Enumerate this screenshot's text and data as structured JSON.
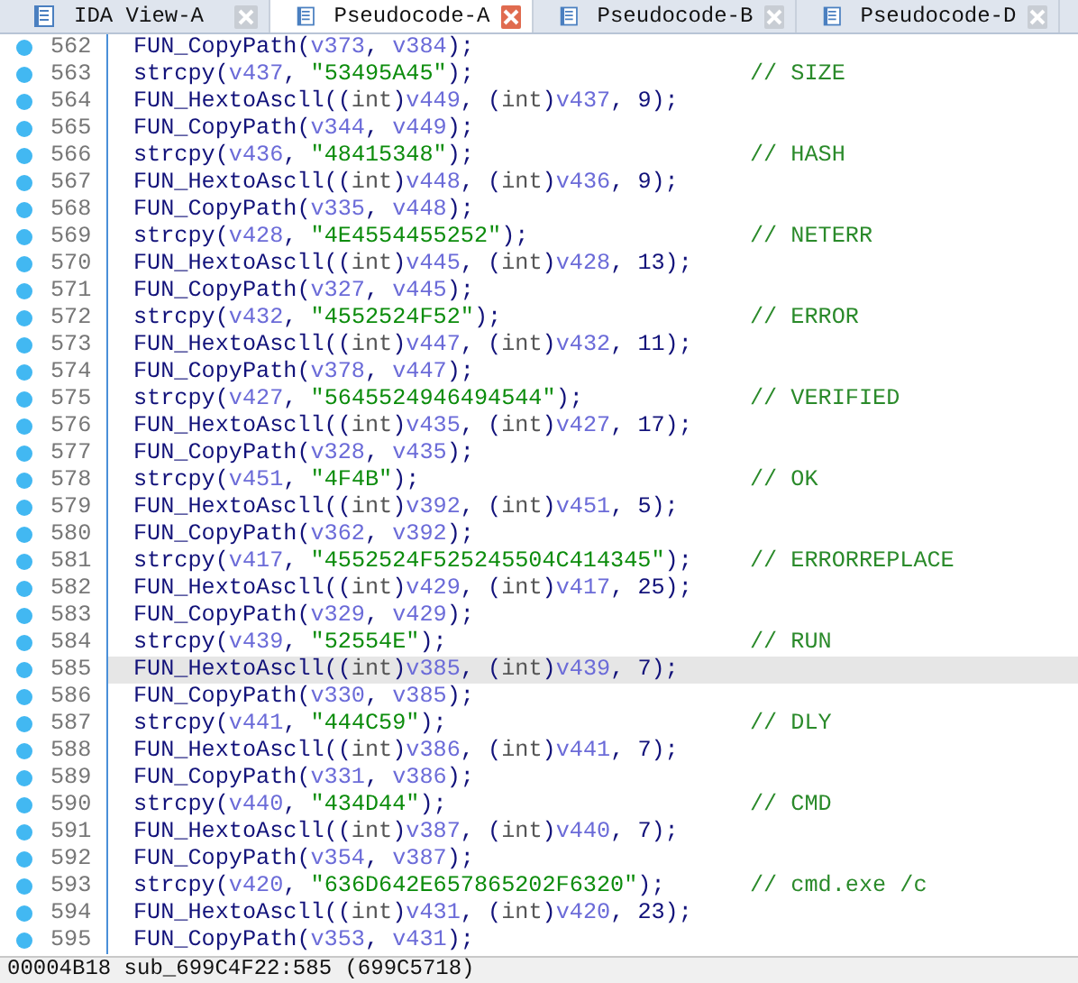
{
  "tabs": [
    {
      "label": "IDA View-A",
      "selected": false
    },
    {
      "label": "Pseudocode-A",
      "selected": true
    },
    {
      "label": "Pseudocode-B",
      "selected": false
    },
    {
      "label": "Pseudocode-D",
      "selected": false
    }
  ],
  "lines": [
    {
      "number": "562",
      "code": "FUN_CopyPath(v373, v384);",
      "current": false
    },
    {
      "number": "563",
      "code": "strcpy(v437, \"53495A45\");",
      "comment": "// SIZE",
      "current": false
    },
    {
      "number": "564",
      "code": "FUN_HextoAscll((int)v449, (int)v437, 9);",
      "current": false
    },
    {
      "number": "565",
      "code": "FUN_CopyPath(v344, v449);",
      "current": false
    },
    {
      "number": "566",
      "code": "strcpy(v436, \"48415348\");",
      "comment": "// HASH",
      "current": false
    },
    {
      "number": "567",
      "code": "FUN_HextoAscll((int)v448, (int)v436, 9);",
      "current": false
    },
    {
      "number": "568",
      "code": "FUN_CopyPath(v335, v448);",
      "current": false
    },
    {
      "number": "569",
      "code": "strcpy(v428, \"4E4554455252\");",
      "comment": "// NETERR",
      "current": false
    },
    {
      "number": "570",
      "code": "FUN_HextoAscll((int)v445, (int)v428, 13);",
      "current": false
    },
    {
      "number": "571",
      "code": "FUN_CopyPath(v327, v445);",
      "current": false
    },
    {
      "number": "572",
      "code": "strcpy(v432, \"4552524F52\");",
      "comment": "// ERROR",
      "current": false
    },
    {
      "number": "573",
      "code": "FUN_HextoAscll((int)v447, (int)v432, 11);",
      "current": false
    },
    {
      "number": "574",
      "code": "FUN_CopyPath(v378, v447);",
      "current": false
    },
    {
      "number": "575",
      "code": "strcpy(v427, \"5645524946494544\");",
      "comment": "// VERIFIED",
      "current": false
    },
    {
      "number": "576",
      "code": "FUN_HextoAscll((int)v435, (int)v427, 17);",
      "current": false
    },
    {
      "number": "577",
      "code": "FUN_CopyPath(v328, v435);",
      "current": false
    },
    {
      "number": "578",
      "code": "strcpy(v451, \"4F4B\");",
      "comment": "// OK",
      "current": false
    },
    {
      "number": "579",
      "code": "FUN_HextoAscll((int)v392, (int)v451, 5);",
      "current": false
    },
    {
      "number": "580",
      "code": "FUN_CopyPath(v362, v392);",
      "current": false
    },
    {
      "number": "581",
      "code": "strcpy(v417, \"4552524F525245504C414345\");",
      "comment": "// ERRORREPLACE",
      "current": false
    },
    {
      "number": "582",
      "code": "FUN_HextoAscll((int)v429, (int)v417, 25);",
      "current": false
    },
    {
      "number": "583",
      "code": "FUN_CopyPath(v329, v429);",
      "current": false
    },
    {
      "number": "584",
      "code": "strcpy(v439, \"52554E\");",
      "comment": "// RUN",
      "current": false
    },
    {
      "number": "585",
      "code": "FUN_HextoAscll((int)v385, (int)v439, 7);",
      "current": true
    },
    {
      "number": "586",
      "code": "FUN_CopyPath(v330, v385);",
      "current": false
    },
    {
      "number": "587",
      "code": "strcpy(v441, \"444C59\");",
      "comment": "// DLY",
      "current": false
    },
    {
      "number": "588",
      "code": "FUN_HextoAscll((int)v386, (int)v441, 7);",
      "current": false
    },
    {
      "number": "589",
      "code": "FUN_CopyPath(v331, v386);",
      "current": false
    },
    {
      "number": "590",
      "code": "strcpy(v440, \"434D44\");",
      "comment": "// CMD",
      "current": false
    },
    {
      "number": "591",
      "code": "FUN_HextoAscll((int)v387, (int)v440, 7);",
      "current": false
    },
    {
      "number": "592",
      "code": "FUN_CopyPath(v354, v387);",
      "current": false
    },
    {
      "number": "593",
      "code": "strcpy(v420, \"636D642E657865202F6320\");",
      "comment": "// cmd.exe /c",
      "current": false
    },
    {
      "number": "594",
      "code": "FUN_HextoAscll((int)v431, (int)v420, 23);",
      "current": false
    },
    {
      "number": "595",
      "code": "FUN_CopyPath(v353, v431);",
      "current": false
    }
  ],
  "status_bar": "00004B18 sub_699C4F22:585 (699C5718)"
}
